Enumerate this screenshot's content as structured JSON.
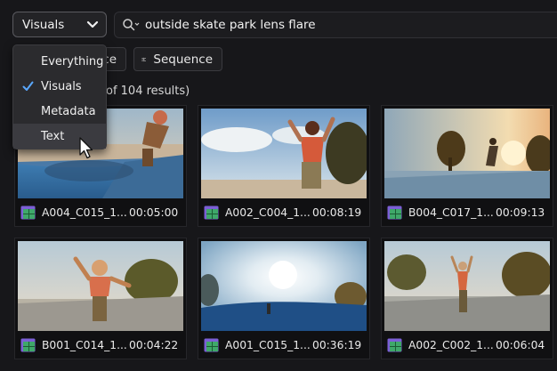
{
  "search": {
    "filter_label": "Visuals",
    "query": "outside skate park lens flare"
  },
  "dropdown": {
    "items": [
      {
        "label": "Everything",
        "checked": false
      },
      {
        "label": "Visuals",
        "checked": true
      },
      {
        "label": "Metadata",
        "checked": false
      },
      {
        "label": "Text",
        "checked": false
      }
    ]
  },
  "view_buttons": {
    "source_label_visible": "ce",
    "sequence_label": "Sequence"
  },
  "results": {
    "count_text": "of 104 results)"
  },
  "clips": [
    {
      "name": "A004_C015_1...",
      "duration": "00:05:00"
    },
    {
      "name": "A002_C004_1...",
      "duration": "00:08:19"
    },
    {
      "name": "B004_C017_1...",
      "duration": "00:09:13"
    },
    {
      "name": "B001_C014_1...",
      "duration": "00:04:22"
    },
    {
      "name": "A001_C015_1...",
      "duration": "00:36:19"
    },
    {
      "name": "A002_C002_1...",
      "duration": "00:06:04"
    }
  ],
  "colors": {
    "background": "#17171a",
    "clip_icon": "#3fa86a",
    "clip_icon_accent": "#7b5fd6",
    "checkmark": "#5aa8ff"
  },
  "icons": {
    "filter_dropdown": "chevron-down-icon",
    "search": "search-icon",
    "sequence": "sequence-icon",
    "clip": "clip-icon",
    "selected": "checkmark-icon"
  }
}
